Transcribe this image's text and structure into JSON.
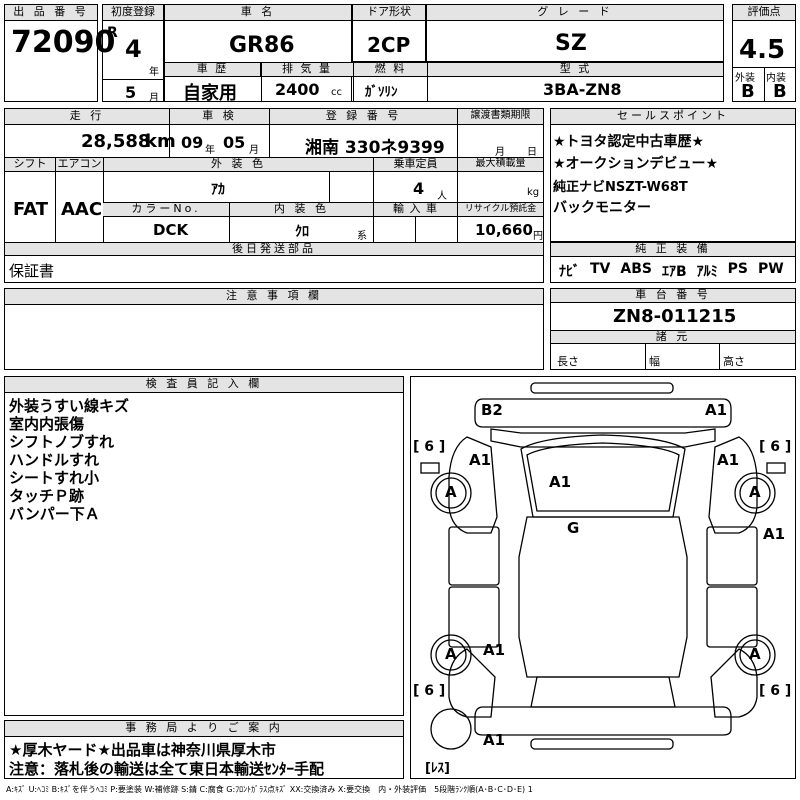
{
  "header": {
    "lot_label": "出 品 番 号",
    "lot_number": "72090",
    "reg_label": "初度登録",
    "era": "R",
    "reg_year": "4",
    "year_unit": "年",
    "reg_month": "5",
    "month_unit": "月",
    "name_label": "車 名",
    "car_name": "GR86",
    "door_label": "ドア形状",
    "door": "2CP",
    "grade_label": "グ レ ー ド",
    "grade": "SZ",
    "score_label": "評価点",
    "score": "4.5",
    "history_label": "車 歴",
    "history": "自家用",
    "displacement_label": "排 気 量",
    "displacement": "2400",
    "cc_unit": "cc",
    "fuel_label": "燃 料",
    "fuel": "ｶﾞｿﾘﾝ",
    "model_label": "型 式",
    "model": "3BA-ZN8",
    "ext_label": "外装",
    "ext_grade": "B",
    "int_label": "内装",
    "int_grade": "B"
  },
  "row2": {
    "mileage_label": "走 行",
    "mileage": "28,588",
    "km_unit": "km",
    "inspection_label": "車 検",
    "insp_year": "09",
    "insp_year_unit": "年",
    "insp_month": "05",
    "insp_month_unit": "月",
    "plate_label": "登 録 番 号",
    "plate": "湘南 330ネ9399",
    "transfer_label": "譲渡書類期限",
    "transfer_month": "月",
    "transfer_day": "日",
    "shift_label": "シフト",
    "shift": "FAT",
    "ac_label": "エアコン",
    "ac": "AAC",
    "color_label": "外 装 色",
    "color": "ｱｶ",
    "capacity_label": "乗車定員",
    "capacity": "4",
    "capacity_unit": "人",
    "payload_label": "最大積載量",
    "payload_unit": "kg",
    "color_no_label": "カラーNo.",
    "color_no": "DCK",
    "int_color_label": "内 装 色",
    "int_color": "ｸﾛ",
    "int_color_unit": "系",
    "import_label": "輸 入 車",
    "recycle_label": "リサイクル預託金",
    "recycle": "10,660",
    "recycle_unit": "円"
  },
  "sales": {
    "label": "セールスポイント",
    "lines": [
      "★トヨタ認定中古車歴★",
      "★オークションデビュー★",
      "純正ナビNSZT-W68T",
      "バックモニター"
    ]
  },
  "later_parts": {
    "label": "後日発送部品",
    "value": "保証書"
  },
  "equipment": {
    "label": "純 正 装 備",
    "items": [
      "ﾅﾋﾞ",
      "TV",
      "ABS",
      "ｴｱB",
      "ｱﾙﾐ",
      "PS",
      "PW"
    ]
  },
  "notes": {
    "label": "注 意 事 項 欄"
  },
  "chassis": {
    "label": "車 台 番 号",
    "value": "ZN8-011215",
    "dims_label": "諸 元",
    "length_label": "長さ",
    "width_label": "幅",
    "height_label": "高さ"
  },
  "inspector": {
    "label": "検 査 員 記 入 欄",
    "lines": [
      "外装うすい線キズ",
      "室内内張傷",
      "シフトノブすれ",
      "ハンドルすれ",
      "シートすれ小",
      "タッチＰ跡",
      "バンパー下Ａ"
    ]
  },
  "office": {
    "label": "事 務 局 よ り ご 案 内",
    "lines": [
      "★厚木ヤード★出品車は神奈川県厚木市",
      "注意：落札後の輸送は全て東日本輸送ｾﾝﾀｰ手配"
    ]
  },
  "diagram": {
    "marks": [
      "B2",
      "A1",
      "A1",
      "A1",
      "A1",
      "G",
      "A1",
      "A1",
      "A1",
      "A",
      "A",
      "A",
      "A"
    ],
    "tire_labels": [
      "[ 6 ]",
      "[ 6 ]",
      "[ 6 ]",
      "[ 6 ]"
    ],
    "spare_label": "[ﾚｽ]"
  },
  "legend": "A:ｷｽﾞ U:ﾍｺﾐ B:ｷｽﾞを伴うﾍｺﾐ P:要塗装 W:補修跡 S:錆 C:腐食 G:ﾌﾛﾝﾄｶﾞﾗｽ点ｷｽﾞ XX:交換済み X:要交換　内・外装評価　5段階ﾗﾝｸ順(A･B･C･D･E) 1"
}
